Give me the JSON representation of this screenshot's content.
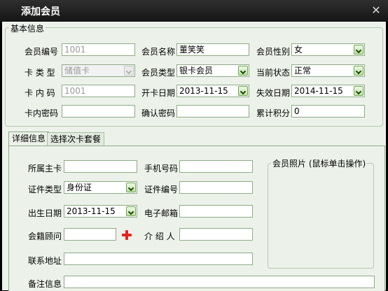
{
  "window": {
    "title": "添加会员",
    "close_glyph": "✕"
  },
  "basic": {
    "legend": "基本信息",
    "member_no": {
      "label": "会员编号",
      "value": "1001"
    },
    "member_name": {
      "label": "会员名称",
      "value": "董笑笑"
    },
    "member_gender": {
      "label": "会员性别",
      "value": "女"
    },
    "card_type": {
      "label": "卡 类 型",
      "value": "储值卡"
    },
    "member_type": {
      "label": "会员类型",
      "value": "银卡会员"
    },
    "current_status": {
      "label": "当前状态",
      "value": "正常"
    },
    "card_inner_no": {
      "label": "卡 内 码",
      "value": "1001"
    },
    "open_date": {
      "label": "开卡日期",
      "value": "2013-11-15"
    },
    "expire_date": {
      "label": "失效日期",
      "value": "2014-11-15"
    },
    "card_password": {
      "label": "卡内密码",
      "value": ""
    },
    "confirm_password": {
      "label": "确认密码",
      "value": ""
    },
    "points": {
      "label": "累计积分",
      "value": "0"
    }
  },
  "tabs": [
    {
      "label": "详细信息",
      "active": true
    },
    {
      "label": "选择次卡套餐",
      "active": false
    }
  ],
  "detail": {
    "main_card": {
      "label": "所属主卡",
      "value": ""
    },
    "mobile": {
      "label": "手机号码",
      "value": ""
    },
    "id_type": {
      "label": "证件类型",
      "value": "身份证"
    },
    "id_no": {
      "label": "证件编号",
      "value": ""
    },
    "birth_date": {
      "label": "出生日期",
      "value": "2013-11-15"
    },
    "email": {
      "label": "电子邮箱",
      "value": ""
    },
    "advisor": {
      "label": "会籍顾问",
      "value": ""
    },
    "referrer": {
      "label": "介 绍 人",
      "value": ""
    },
    "address": {
      "label": "联系地址",
      "value": ""
    },
    "remarks": {
      "label": "备注信息",
      "value": ""
    },
    "photo": {
      "legend": "会员照片 (鼠标单击操作)"
    }
  }
}
